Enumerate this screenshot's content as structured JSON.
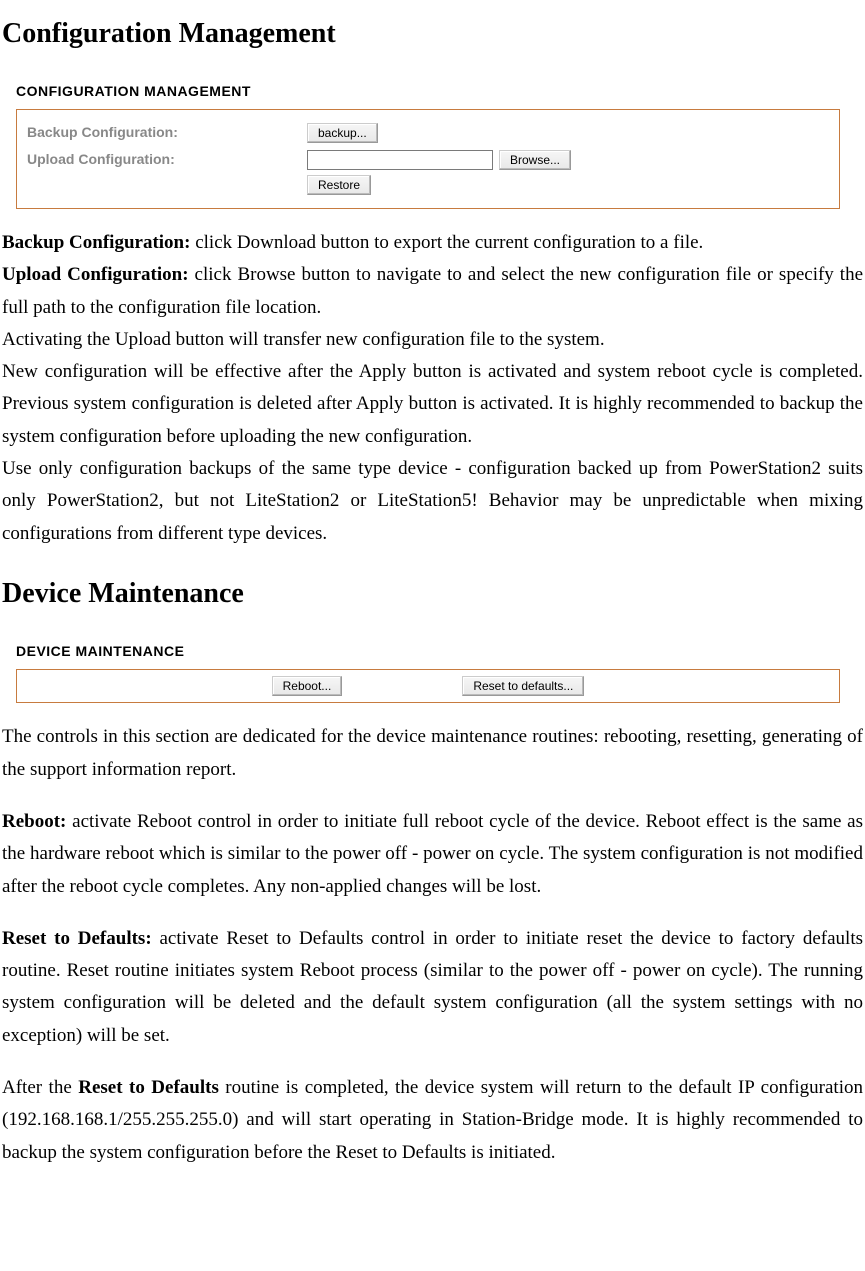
{
  "section1": {
    "heading": "Configuration Management",
    "panelCaption": "CONFIGURATION MANAGEMENT",
    "row1Label": "Backup Configuration:",
    "backupBtn": "backup...",
    "row2Label": "Upload Configuration:",
    "uploadValue": "",
    "browseBtn": "Browse...",
    "restoreBtn": "Restore",
    "p1_bold": "Backup Configuration:",
    "p1_rest": " click Download button to export the current configuration to a file.",
    "p2_bold": "Upload Configuration:",
    "p2_rest": " click Browse button to navigate to and select the new configuration file or specify the full path to the configuration file location.",
    "p3": "Activating the Upload button will transfer new configuration file to the system.",
    "p4": "New configuration will be effective after the Apply button is activated and system reboot cycle is completed. Previous system configuration is deleted after Apply button is activated. It is highly recommended to backup the system configuration before uploading the new configuration.",
    "p5": "Use only configuration backups of the same type device - configuration backed up from PowerStation2 suits only PowerStation2, but not LiteStation2 or LiteStation5! Behavior may be unpredictable when mixing configurations from different type devices."
  },
  "section2": {
    "heading": "Device Maintenance",
    "panelCaption": "DEVICE MAINTENANCE",
    "rebootBtn": "Reboot...",
    "resetBtn": "Reset to defaults...",
    "p1": "The controls in this section are dedicated for the device maintenance routines: rebooting, resetting, generating of the support information report.",
    "p2_bold": "Reboot:",
    "p2_rest": " activate Reboot control in order to initiate full reboot cycle of the device. Reboot effect is the same as the hardware reboot which is similar to the power off - power on cycle. The system configuration is not modified after the reboot cycle completes. Any non-applied changes will be lost.",
    "p3_bold": "Reset to Defaults:",
    "p3_rest": " activate Reset to Defaults control in order to initiate reset the device to factory defaults routine. Reset routine initiates system Reboot process (similar to the power off - power on cycle). The running system configuration will be deleted and the default system configuration (all the system settings with no exception) will be set.",
    "p4_a": "After the ",
    "p4_bold": "Reset to Defaults",
    "p4_b": " routine is completed, the device system will return to the default IP configuration (192.168.168.1/255.255.255.0) and will start operating in Station-Bridge mode. It is highly recommended to backup the system configuration before the Reset to Defaults is initiated."
  }
}
